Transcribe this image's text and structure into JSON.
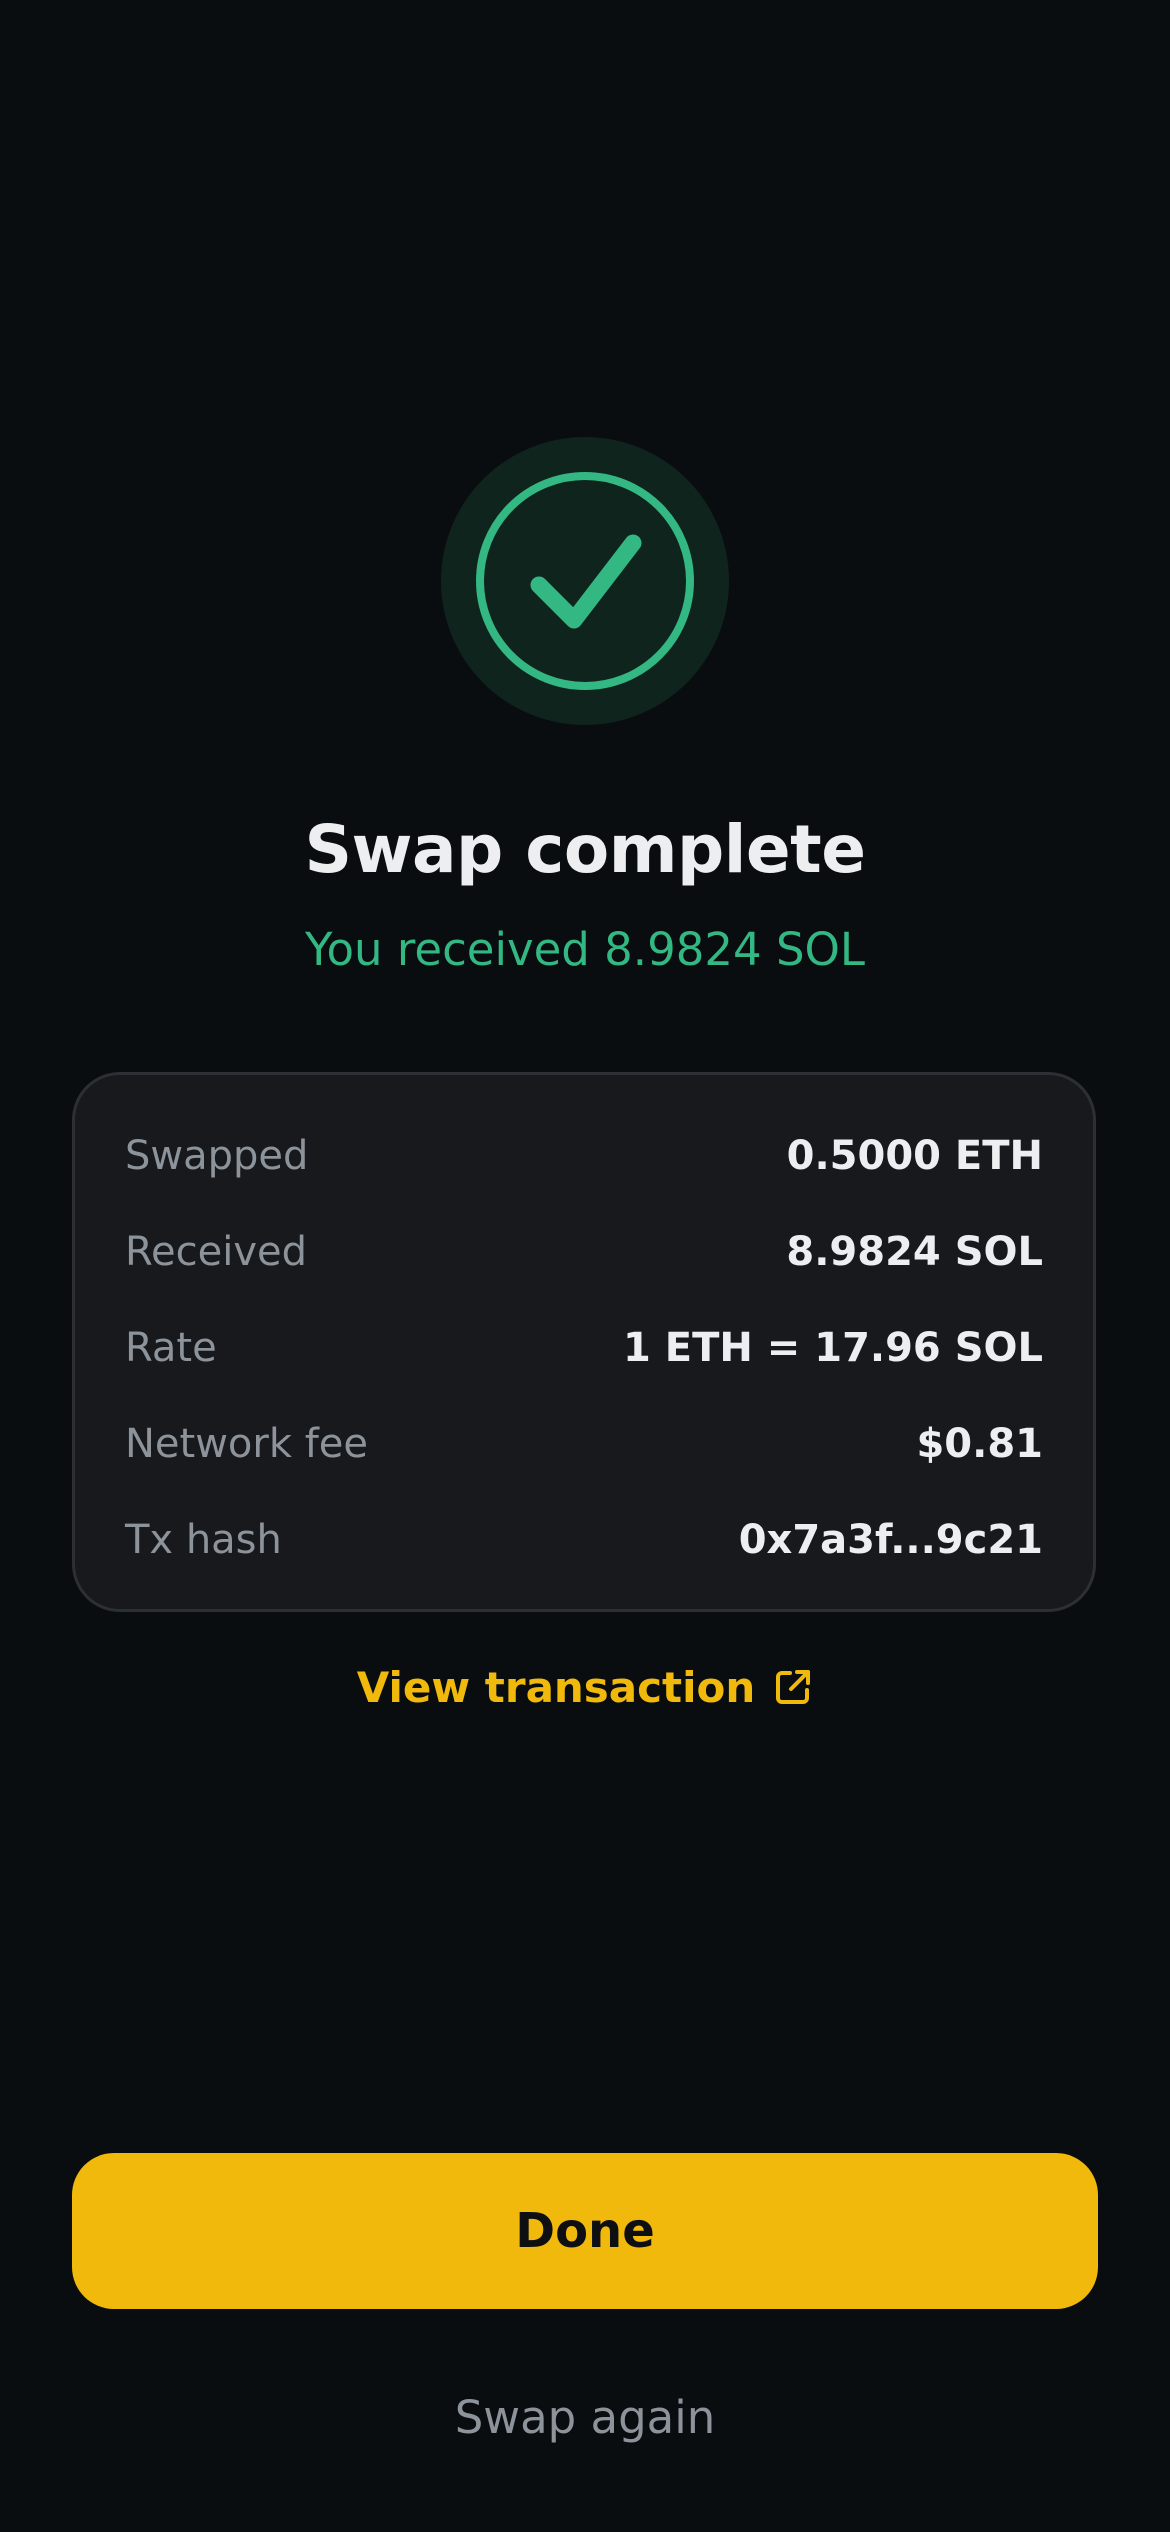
{
  "status": {
    "icon": "check-circle-icon",
    "title": "Swap complete",
    "subtitle": "You received 8.9824 SOL"
  },
  "details": [
    {
      "label": "Swapped",
      "value": "0.5000 ETH"
    },
    {
      "label": "Received",
      "value": "8.9824 SOL"
    },
    {
      "label": "Rate",
      "value": "1 ETH = 17.96 SOL"
    },
    {
      "label": "Network fee",
      "value": "$0.81"
    },
    {
      "label": "Tx hash",
      "value": "0x7a3f...9c21"
    }
  ],
  "links": {
    "view_transaction": "View transaction",
    "view_transaction_icon": "external-link-icon"
  },
  "actions": {
    "done_label": "Done",
    "swap_again_label": "Swap again"
  },
  "colors": {
    "background": "#0a0d10",
    "card": "#17191d",
    "success": "#33b884",
    "accent": "#f0b90b",
    "muted_text": "#8d939b"
  }
}
